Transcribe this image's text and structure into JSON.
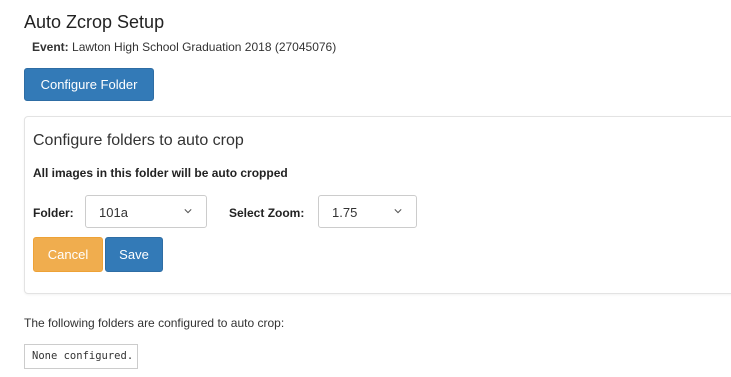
{
  "page": {
    "title": "Auto Zcrop Setup",
    "event_label": "Event:",
    "event_value": "Lawton High School Graduation 2018 (27045076)"
  },
  "toolbar": {
    "configure_folder_label": "Configure Folder"
  },
  "panel": {
    "heading": "Configure folders to auto crop",
    "subheading": "All images in this folder will be auto cropped",
    "folder_label": "Folder:",
    "folder_value": "101a",
    "zoom_label": "Select Zoom:",
    "zoom_value": "1.75",
    "cancel_label": "Cancel",
    "save_label": "Save"
  },
  "configured": {
    "intro": "The following folders are configured to auto crop:",
    "none_text": "None configured."
  },
  "colors": {
    "primary": "#337ab7",
    "warning": "#f0ad4e"
  },
  "icons": {
    "dropdown": "chevron-down-icon"
  }
}
